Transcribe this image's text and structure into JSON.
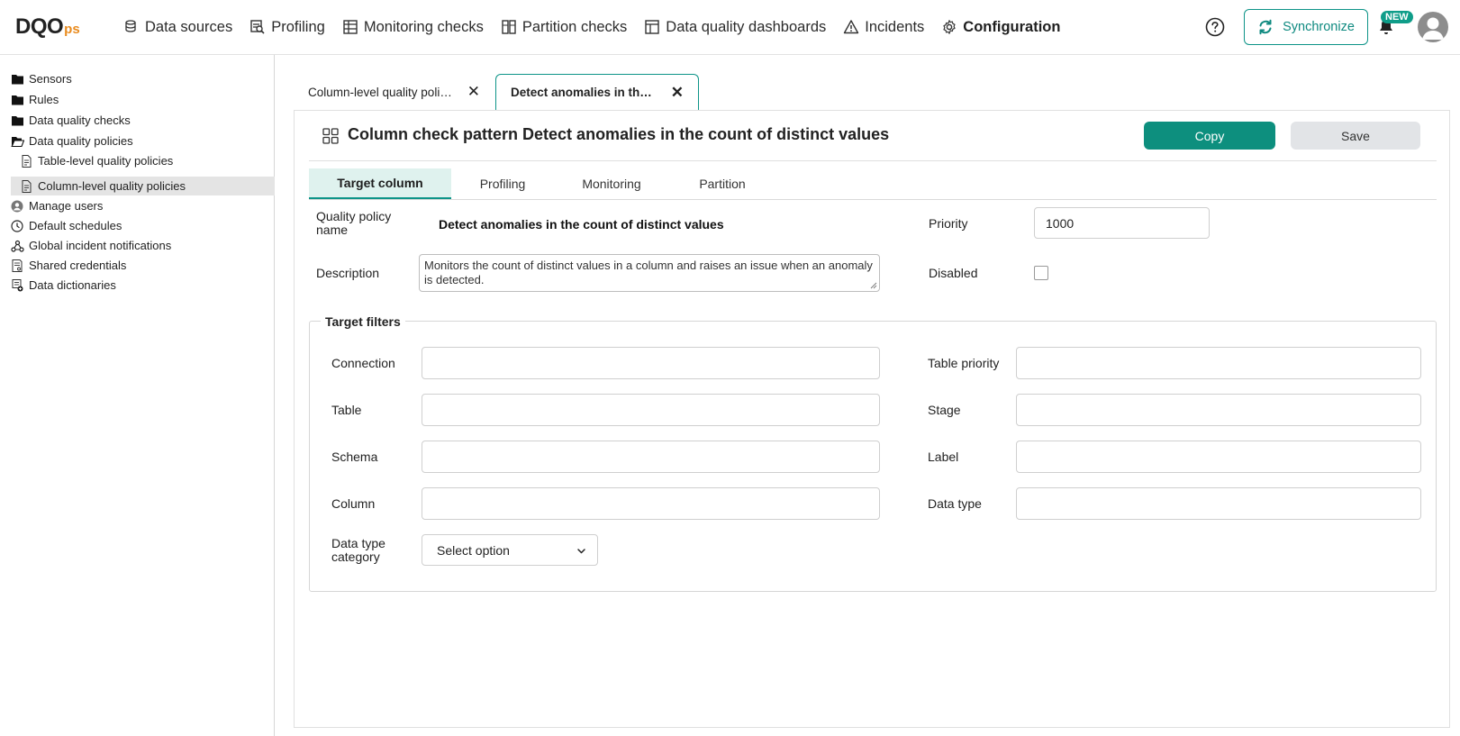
{
  "header": {
    "logo_main": "DQO",
    "logo_suffix": "ps",
    "nav": [
      {
        "label": "Data sources",
        "icon": "database-icon"
      },
      {
        "label": "Profiling",
        "icon": "profiling-icon"
      },
      {
        "label": "Monitoring checks",
        "icon": "table-grid-icon"
      },
      {
        "label": "Partition checks",
        "icon": "partition-icon"
      },
      {
        "label": "Data quality dashboards",
        "icon": "dashboard-icon"
      },
      {
        "label": "Incidents",
        "icon": "warning-icon"
      },
      {
        "label": "Configuration",
        "icon": "gear-icon"
      }
    ],
    "sync_label": "Synchronize",
    "new_badge": "NEW"
  },
  "sidebar": {
    "items": [
      {
        "label": "Sensors",
        "icon": "folder-icon"
      },
      {
        "label": "Rules",
        "icon": "folder-icon"
      },
      {
        "label": "Data quality checks",
        "icon": "folder-icon"
      },
      {
        "label": "Data quality policies",
        "icon": "folder-open-icon"
      },
      {
        "label": "Table-level quality policies",
        "icon": "policy-file-icon"
      },
      {
        "label": "Column-level quality policies",
        "icon": "policy-file-icon"
      },
      {
        "label": "Manage users",
        "icon": "user-icon"
      },
      {
        "label": "Default schedules",
        "icon": "clock-icon"
      },
      {
        "label": "Global incident notifications",
        "icon": "webhook-icon"
      },
      {
        "label": "Shared credentials",
        "icon": "credentials-icon"
      },
      {
        "label": "Data dictionaries",
        "icon": "dictionary-icon"
      }
    ]
  },
  "tabs": [
    {
      "label": "Column-level quality policies"
    },
    {
      "label": "Detect anomalies in the count of distinct values"
    }
  ],
  "page": {
    "title": "Column check pattern Detect anomalies in the count of distinct values",
    "copy_label": "Copy",
    "save_label": "Save",
    "sub_tabs": [
      "Target column",
      "Profiling",
      "Monitoring",
      "Partition"
    ]
  },
  "form": {
    "policy_name_label": "Quality policy name",
    "policy_name_value": "Detect anomalies in the count of distinct values",
    "description_label": "Description",
    "description_value": "Monitors the count of distinct values in a column and raises an issue when an anomaly is detected.",
    "priority_label": "Priority",
    "priority_value": "1000",
    "disabled_label": "Disabled"
  },
  "filters": {
    "legend": "Target filters",
    "connection_label": "Connection",
    "table_label": "Table",
    "schema_label": "Schema",
    "column_label": "Column",
    "data_type_category_label": "Data type category",
    "data_type_category_value": "Select option",
    "table_priority_label": "Table priority",
    "stage_label": "Stage",
    "label_label": "Label",
    "data_type_label": "Data type"
  }
}
